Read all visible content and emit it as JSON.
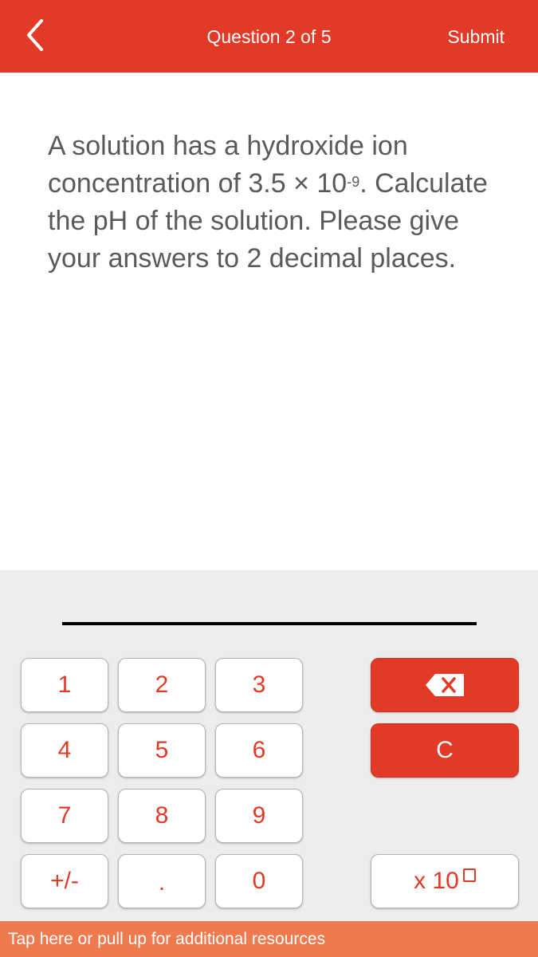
{
  "header": {
    "title": "Question 2 of 5",
    "submit_label": "Submit",
    "back_icon": "chevron-left-icon"
  },
  "question": {
    "line1": "A solution has a hydroxide ion concentration of 3.5 × 10",
    "exponent": "-9",
    "line2": ". Calculate the pH of the solution. Please give your answers to 2 decimal places."
  },
  "answer": {
    "value": ""
  },
  "keypad": {
    "keys": [
      "1",
      "2",
      "3",
      "4",
      "5",
      "6",
      "7",
      "8",
      "9",
      "+/-",
      ".",
      "0"
    ],
    "backspace_icon": "backspace-icon",
    "clear_label": "C",
    "times_ten_label": "x 10"
  },
  "footer": {
    "label": "Tap here or pull up for additional resources"
  },
  "colors": {
    "brand": "#E23A26",
    "footer": "#EF7A4E",
    "keypad_bg": "#EDEDED"
  }
}
